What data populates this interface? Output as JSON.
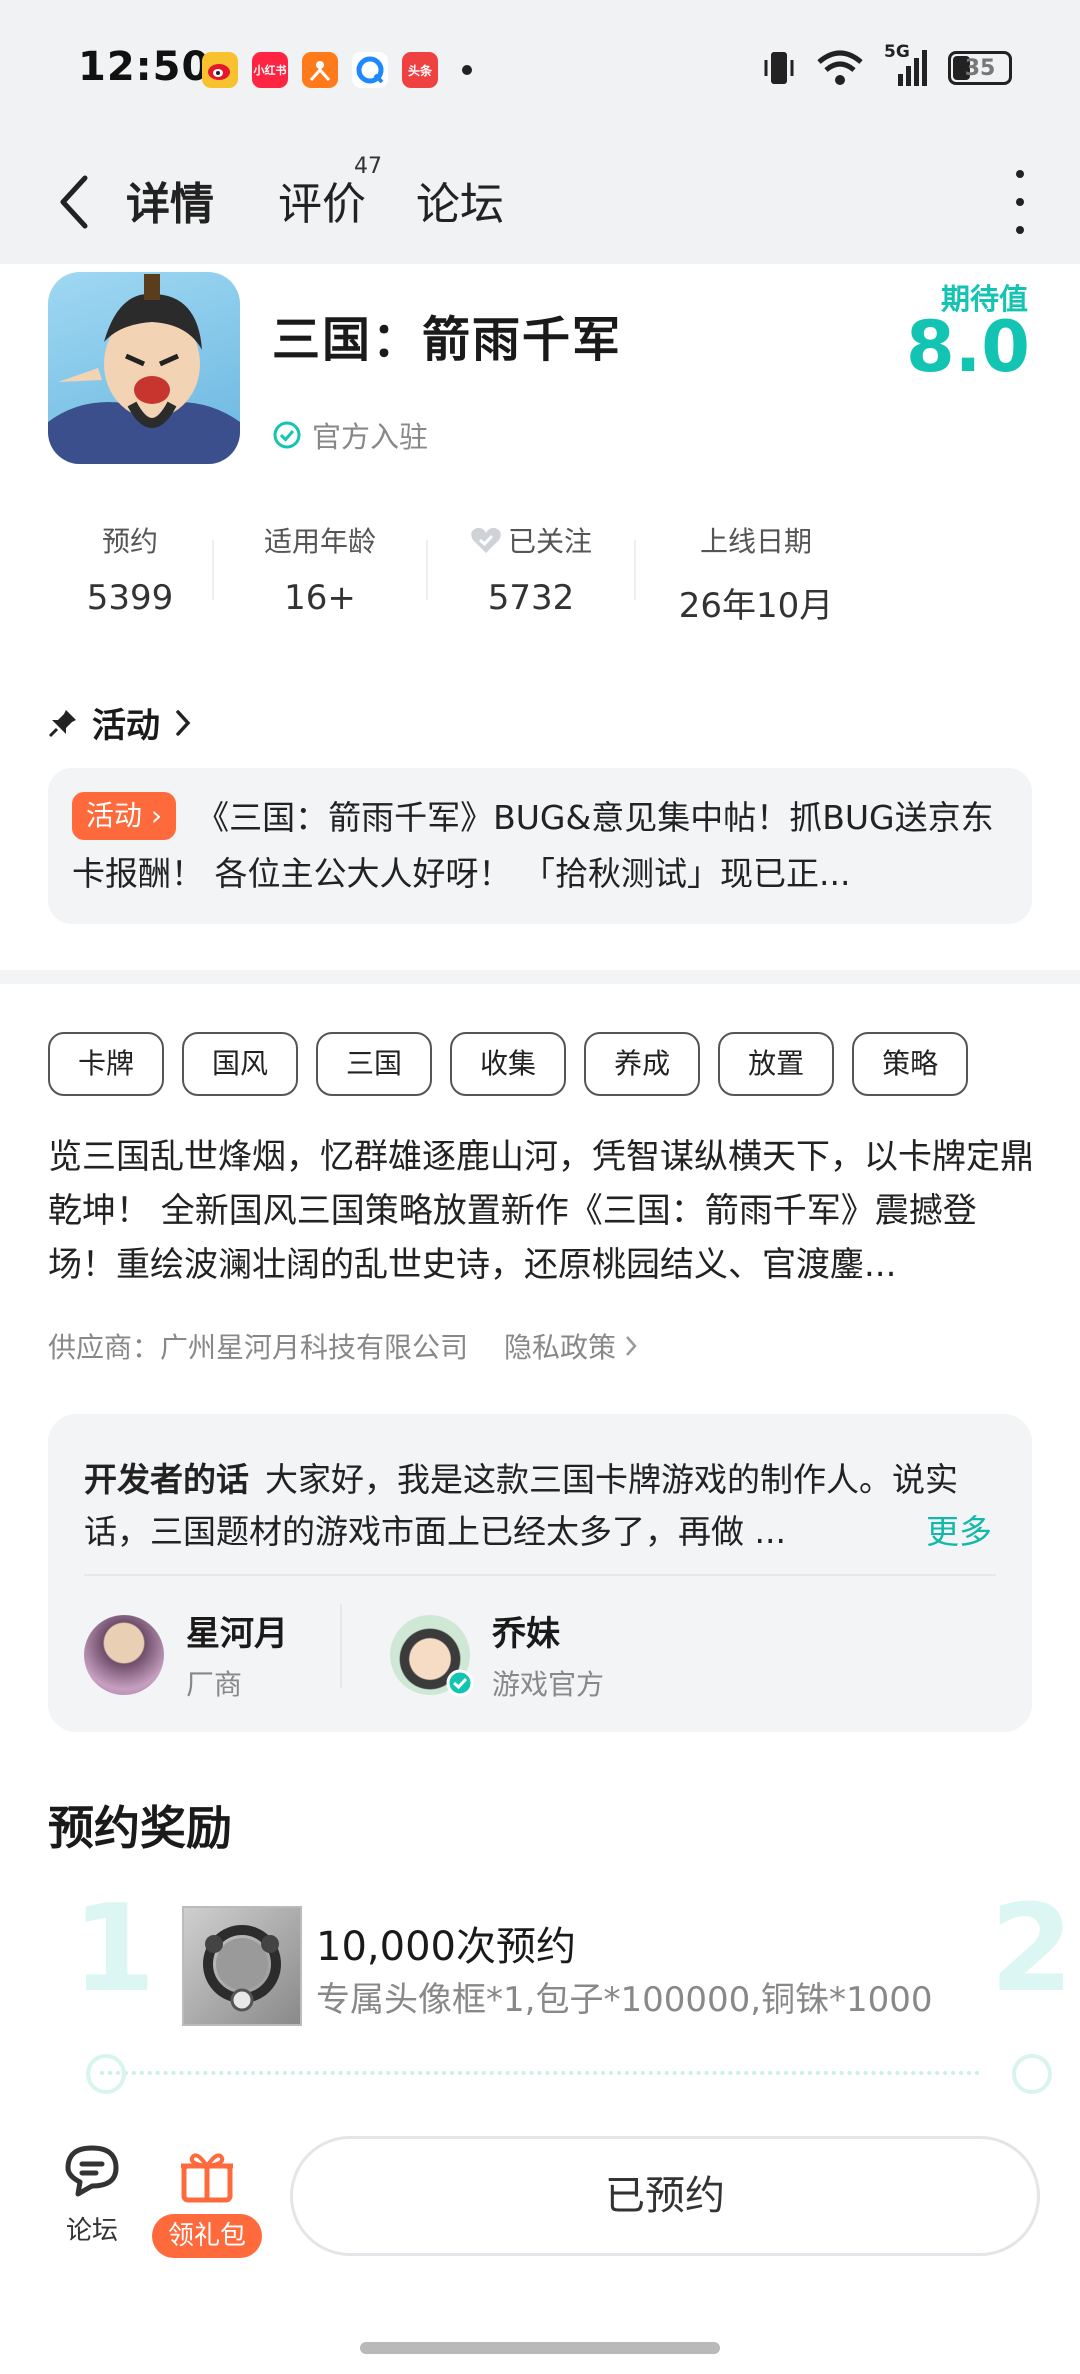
{
  "status_bar": {
    "time": "12:50",
    "notif_apps": [
      {
        "name": "weibo-icon",
        "color": "#f7a21b",
        "text": ""
      },
      {
        "name": "xiaohongshu-icon",
        "color": "#ff2442",
        "text": "小红书"
      },
      {
        "name": "app-orange-icon",
        "color": "#ff7a1a",
        "text": ""
      },
      {
        "name": "browser-icon",
        "color": "#ffffff",
        "text": ""
      },
      {
        "name": "toutiao-icon",
        "color": "#f04142",
        "text": "头条"
      }
    ],
    "network": "5G",
    "battery": "35"
  },
  "nav": {
    "tab_detail": "详情",
    "tab_review": "评价",
    "review_count": "47",
    "tab_forum": "论坛"
  },
  "game": {
    "title": "三国：箭雨千军",
    "official_label": "官方入驻",
    "rating_label": "期待值",
    "rating_value": "8.0"
  },
  "stats": [
    {
      "label": "预约",
      "value": "5399"
    },
    {
      "label": "适用年龄",
      "value": "16+"
    },
    {
      "label": "已关注",
      "value": "5732"
    },
    {
      "label": "上线日期",
      "value": "26年10月"
    }
  ],
  "activity": {
    "section_title": "活动",
    "badge": "活动",
    "text": "《三国：箭雨千军》BUG&意见集中帖！抓BUG送京东卡报酬！ 各位主公大人好呀！ 「拾秋测试」现已正..."
  },
  "tags": [
    "卡牌",
    "国风",
    "三国",
    "收集",
    "养成",
    "放置",
    "策略"
  ],
  "description": "览三国乱世烽烟，忆群雄逐鹿山河，凭智谋纵横天下，以卡牌定鼎乾坤！ 全新国风三国策略放置新作《三国：箭雨千军》震撼登场！重绘波澜壮阔的乱世史诗，还原桃园结义、官渡鏖...",
  "supplier": {
    "text": "供应商：广州星河月科技有限公司",
    "privacy": "隐私政策"
  },
  "developer": {
    "label": "开发者的话",
    "text": "大家好，我是这款三国卡牌游戏的制作人。说实话，三国题材的游戏市面上已经太多了，再做 ...",
    "more": "更多",
    "people": [
      {
        "name": "星河月",
        "role": "厂商"
      },
      {
        "name": "乔妹",
        "role": "游戏官方"
      }
    ]
  },
  "rewards": {
    "title": "预约奖励",
    "items": [
      {
        "number": "1",
        "name": "10,000次预约",
        "desc": "专属头像框*1,包子*100000,铜铢*1000"
      },
      {
        "number": "2"
      }
    ]
  },
  "bottom": {
    "forum": "论坛",
    "gift": "领礼包",
    "reserved": "已预约"
  }
}
